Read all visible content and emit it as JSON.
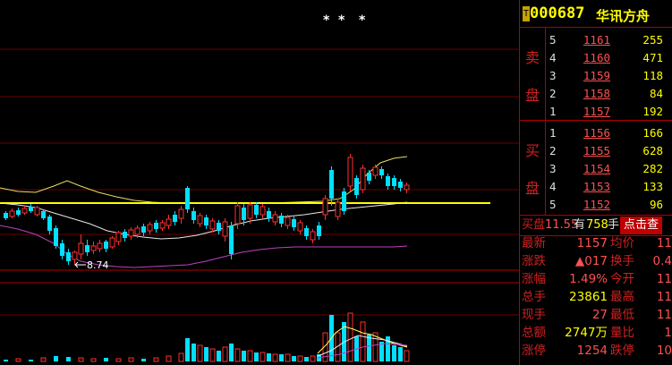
{
  "stock": {
    "tag": "T",
    "code": "000687",
    "name": "华讯方舟"
  },
  "chart": {
    "markers": [
      "*",
      "*",
      "*"
    ],
    "low_annotation": "8.74"
  },
  "order_book": {
    "sell_label": [
      "卖",
      "盘"
    ],
    "buy_label": [
      "买",
      "盘"
    ],
    "asks": [
      {
        "level": "5",
        "price": "1161",
        "volume": "255"
      },
      {
        "level": "4",
        "price": "1160",
        "volume": "471"
      },
      {
        "level": "3",
        "price": "1159",
        "volume": "118"
      },
      {
        "level": "2",
        "price": "1158",
        "volume": "84"
      },
      {
        "level": "1",
        "price": "1157",
        "volume": "192"
      }
    ],
    "bids": [
      {
        "level": "1",
        "price": "1156",
        "volume": "166"
      },
      {
        "level": "2",
        "price": "1155",
        "volume": "628"
      },
      {
        "level": "3",
        "price": "1154",
        "volume": "282"
      },
      {
        "level": "4",
        "price": "1153",
        "volume": "133"
      },
      {
        "level": "5",
        "price": "1152",
        "volume": "96"
      }
    ]
  },
  "bid_line": {
    "label": "买盘",
    "price": "11.55",
    "has": "有",
    "volume": "758",
    "unit": "手",
    "button": "点击查"
  },
  "quotes": [
    {
      "l1": "最新",
      "v1": "1157",
      "c1": "#ff5050",
      "l2": "均价",
      "v2": "11"
    },
    {
      "l1": "涨跌",
      "v1": "▲017",
      "c1": "#ff5050",
      "l2": "换手",
      "v2": "0.4"
    },
    {
      "l1": "涨幅",
      "v1": "1.49%",
      "c1": "#ff5050",
      "l2": "今开",
      "v2": "11"
    },
    {
      "l1": "总手",
      "v1": "23861",
      "c1": "#ffff00",
      "l2": "最高",
      "v2": "11"
    },
    {
      "l1": "现手",
      "v1": "27",
      "c1": "#ff5050",
      "l2": "最低",
      "v2": "11"
    },
    {
      "l1": "总额",
      "v1": "2747万",
      "c1": "#ffff00",
      "l2": "量比",
      "v2": "1"
    },
    {
      "l1": "涨停",
      "v1": "1254",
      "c1": "#ff5050",
      "l2": "跌停",
      "v2": "10"
    }
  ],
  "colors": {
    "up": "#ff3030",
    "down": "#00e0ff",
    "ma_yellow": "#ffff60",
    "ma_white": "#e8e8e8",
    "ma_magenta": "#d040d0",
    "grid": "#8b0000"
  }
}
